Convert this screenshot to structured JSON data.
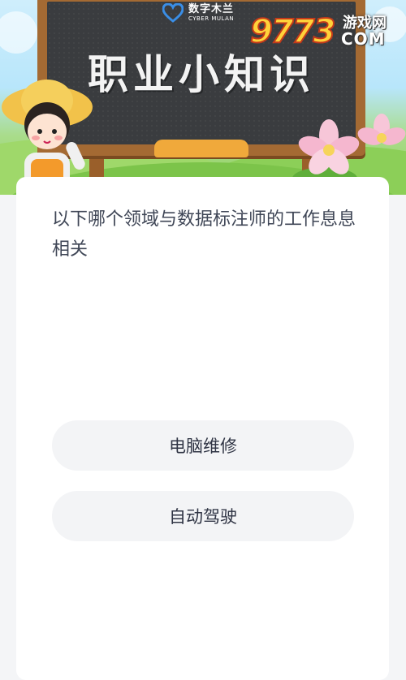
{
  "banner": {
    "brand_name": "数字木兰",
    "brand_name_en": "CYBER MULAN",
    "board_title": "职业小知识",
    "watermark_digits": "9773",
    "watermark_site": "游戏网",
    "watermark_com": "COM"
  },
  "quiz": {
    "question": "以下哪个领域与数据标注师的工作息息相关",
    "options": [
      {
        "label": "电脑维修"
      },
      {
        "label": "自动驾驶"
      }
    ]
  },
  "colors": {
    "page_bg": "#f4f5f7",
    "card_bg": "#ffffff",
    "option_bg": "#f3f4f6",
    "question_text": "#3f4656",
    "board": "#3a3c3f",
    "board_frame": "#a46a33"
  }
}
